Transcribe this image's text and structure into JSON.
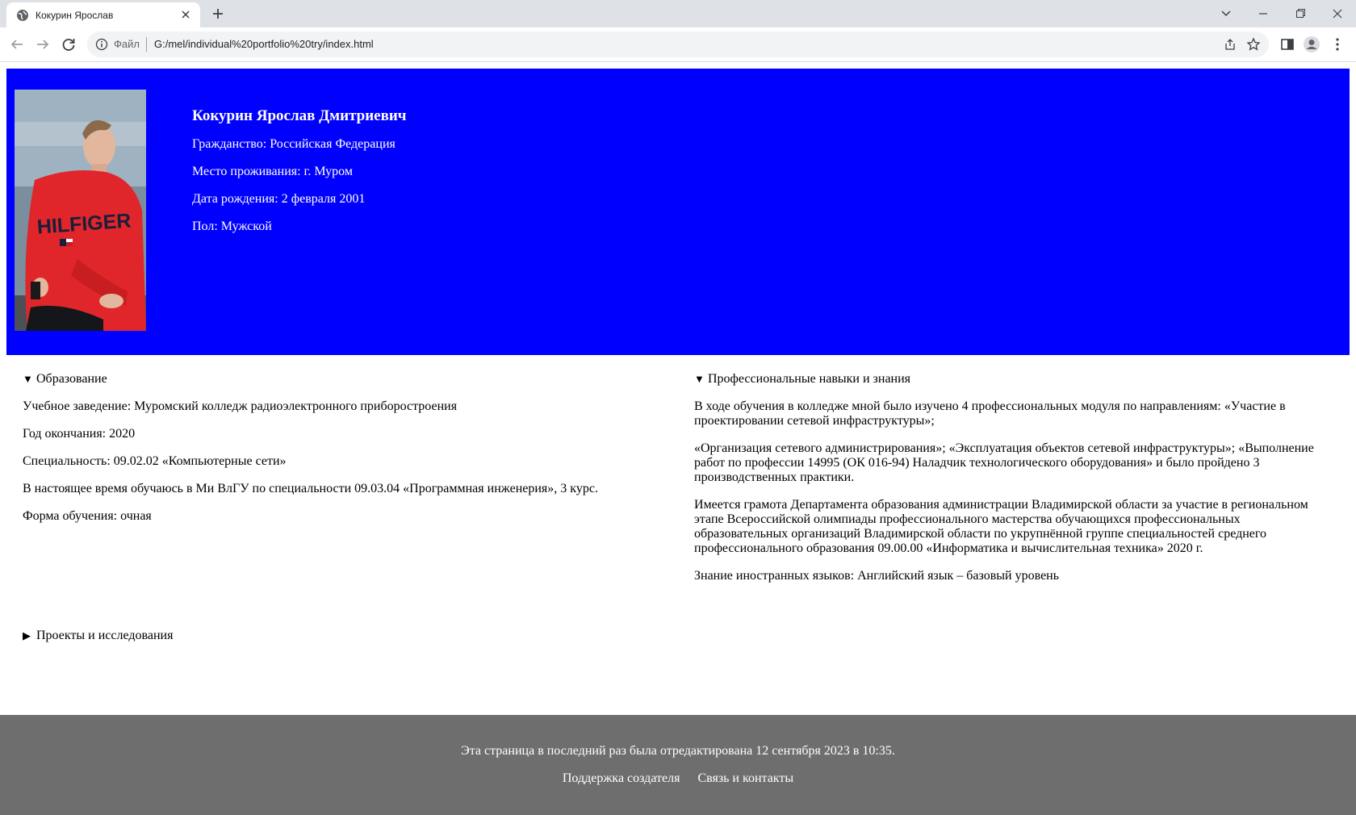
{
  "browser": {
    "tab_title": "Кокурин Ярослав",
    "scheme_label": "Файл",
    "url": "G:/mel/individual%20portfolio%20try/index.html"
  },
  "header": {
    "name": "Кокурин Ярослав Дмитриевич",
    "citizenship": "Гражданство: Российская Федерация",
    "residence": "Место проживания: г. Муром",
    "birth_date": "Дата рождения: 2 февраля 2001",
    "gender": "Пол: Мужской",
    "photo_text": "HILFIGER",
    "colors": {
      "background": "#0000ff",
      "text": "#ffffff",
      "sweater": "#e0262b"
    }
  },
  "education": {
    "summary": "Образование",
    "expanded": true,
    "lines": [
      "Учебное заведение: Муромский колледж радиоэлектронного приборостроения",
      "Год окончания: 2020",
      "Специальность: 09.02.02 «Компьютерные сети»",
      "В настоящее время обучаюсь в Ми ВлГУ по специальности 09.03.04 «Программная инженерия», 3 курс.",
      "Форма обучения: очная"
    ]
  },
  "skills": {
    "summary": "Профессиональные навыки и знания",
    "expanded": true,
    "paragraphs": [
      "В ходе обучения в колледже мной было изучено 4 профессиональных модуля по направлениям: «Участие в проектировании сетевой инфраструктуры»;",
      "«Организация сетевого администрирования»; «Эксплуатация объектов сетевой инфраструктуры»; «Выполнение работ по профессии 14995 (ОК 016-94) Наладчик технологического оборудования» и было пройдено 3 производственных практики.",
      "Имеется грамота Департамента образования администрации Владимирской области за участие в региональном этапе Всероссийской олимпиады профессионального мастерства обучающихся профессиональных образовательных организаций Владимирской области по укрупнённой группе специальностей среднего профессионального образования 09.00.00 «Информатика и вычислительная техника» 2020 г.",
      "Знание иностранных языков: Английский язык – базовый уровень"
    ]
  },
  "projects": {
    "summary": "Проекты и исследования",
    "expanded": false
  },
  "footer": {
    "edited": "Эта страница в последний раз была отредактирована 12 сентября 2023 в 10:35.",
    "link_support": "Поддержка создателя",
    "link_contacts": "Связь и контакты",
    "background": "#6e6e6e"
  }
}
